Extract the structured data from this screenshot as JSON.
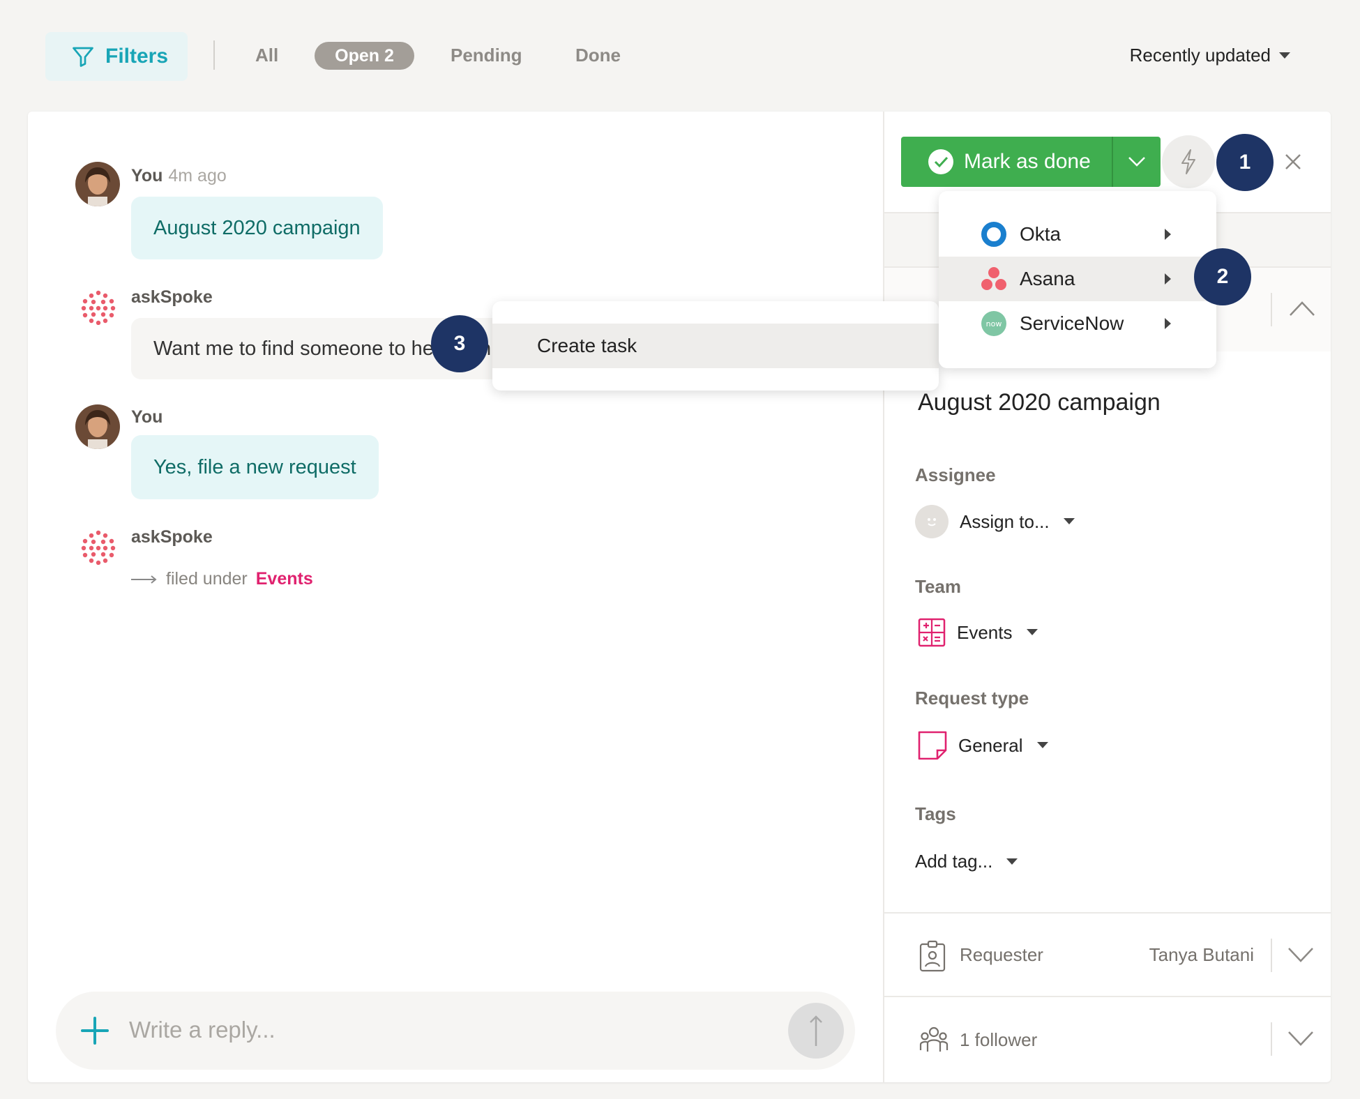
{
  "filters": {
    "label": "Filters",
    "tabs": {
      "all": "All",
      "open": "Open 2",
      "pending": "Pending",
      "done": "Done"
    },
    "sort": "Recently updated"
  },
  "conversation": {
    "messages": [
      {
        "author": "You",
        "time": "4m ago",
        "text": "August 2020 campaign"
      },
      {
        "author": "askSpoke",
        "text": "Want me to find someone to help with this?"
      },
      {
        "author": "You",
        "text": "Yes, file a new request"
      },
      {
        "author": "askSpoke",
        "filed_prefix": "filed under",
        "filed_category": "Events"
      }
    ],
    "reply_placeholder": "Write a reply..."
  },
  "panel": {
    "mark_done": "Mark as done",
    "request_title": "August 2020 campaign",
    "assignee": {
      "label": "Assignee",
      "value": "Assign to..."
    },
    "team": {
      "label": "Team",
      "value": "Events"
    },
    "request_type": {
      "label": "Request type",
      "value": "General"
    },
    "tags": {
      "label": "Tags",
      "value": "Add tag..."
    },
    "requester": {
      "label": "Requester",
      "value": "Tanya Butani"
    },
    "followers": {
      "label": "1 follower"
    }
  },
  "integrations_menu": {
    "items": [
      {
        "label": "Okta",
        "icon": "okta-icon"
      },
      {
        "label": "Asana",
        "icon": "asana-icon",
        "highlighted": true
      },
      {
        "label": "ServiceNow",
        "icon": "servicenow-icon"
      }
    ]
  },
  "asana_submenu": {
    "item": "Create task"
  },
  "steps": [
    "1",
    "2",
    "3"
  ],
  "colors": {
    "accent_teal": "#18a5b6",
    "done_green": "#3fae4f",
    "category_pink": "#e0226f",
    "badge_navy": "#1e3465"
  }
}
